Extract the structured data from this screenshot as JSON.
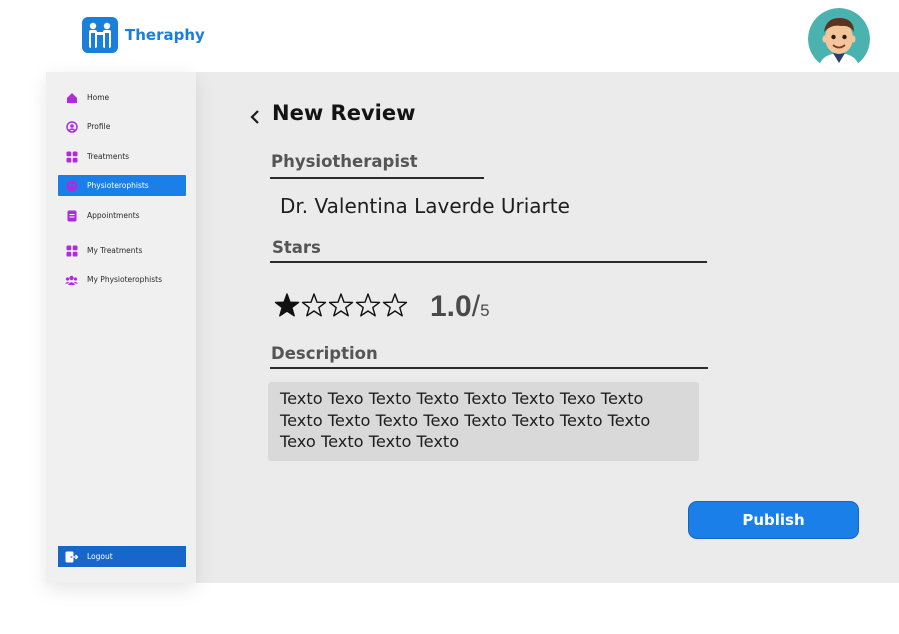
{
  "app": {
    "name": "Theraphy"
  },
  "sidebar": {
    "items": [
      {
        "label": "Home",
        "icon": "home-icon"
      },
      {
        "label": "Profile",
        "icon": "profile-icon"
      },
      {
        "label": "Treatments",
        "icon": "grid-icon"
      },
      {
        "label": "Physioterophists",
        "icon": "people-icon",
        "active": true
      },
      {
        "label": "Appointments",
        "icon": "document-icon"
      },
      {
        "label": "My Treatments",
        "icon": "grid-icon"
      },
      {
        "label": "My Physioterophists",
        "icon": "group-icon"
      }
    ],
    "logout_label": "Logout"
  },
  "review": {
    "title": "New Review",
    "physio_label": "Physiotherapist",
    "physio_name": "Dr. Valentina Laverde Uriarte",
    "stars_label": "Stars",
    "stars_filled": 1,
    "stars_total": 5,
    "rating_value": "1.0",
    "rating_slash": "/",
    "rating_max": "5",
    "description_label": "Description",
    "description_text": "Texto Texo Texto Texto Texto Texto Texo Texto Texto Texto Texto Texo Texto Texto Texto Texto Texo Texto Texto Texto",
    "publish_label": "Publish"
  },
  "colors": {
    "accent": "#1a7fe8",
    "brand": "#1a7fd9",
    "icon_purple": "#b02ae0",
    "panel": "#ebebeb"
  }
}
